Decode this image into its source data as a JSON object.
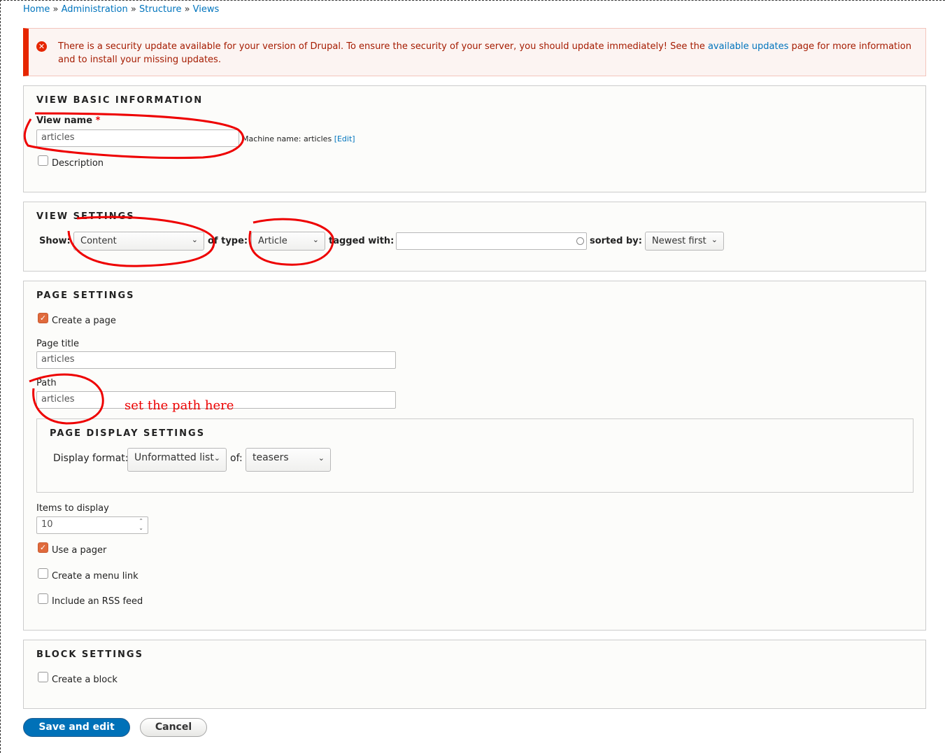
{
  "breadcrumb": [
    "Home",
    "Administration",
    "Structure",
    "Views"
  ],
  "message": {
    "text_before": "There is a security update available for your version of Drupal. To ensure the security of your server, you should update immediately! See the ",
    "link": "available updates",
    "text_after": " page for more information and to install your missing updates.",
    "icon": "error-circle-icon"
  },
  "basic": {
    "legend": "VIEW BASIC INFORMATION",
    "name_label": "View name",
    "required": "*",
    "name_value": "articles",
    "machine_label": "Machine name: articles",
    "edit": "[Edit]",
    "description": "Description"
  },
  "settings": {
    "legend": "VIEW SETTINGS",
    "show": "Show:",
    "show_value": "Content",
    "of_type": "of type:",
    "type_value": "Article",
    "tagged": "tagged with:",
    "tagged_value": "",
    "sorted": "sorted by:",
    "sorted_value": "Newest first"
  },
  "page": {
    "legend": "PAGE SETTINGS",
    "create": "Create a page",
    "create_checked": true,
    "title_label": "Page title",
    "title_value": "articles",
    "path_label": "Path",
    "path_value": "articles",
    "display": {
      "legend": "PAGE DISPLAY SETTINGS",
      "format_label": "Display format:",
      "format_value": "Unformatted list",
      "of": "of:",
      "of_value": "teasers"
    },
    "items_label": "Items to display",
    "items_value": "10",
    "pager": "Use a pager",
    "pager_checked": true,
    "menu": "Create a menu link",
    "menu_checked": false,
    "rss": "Include an RSS feed",
    "rss_checked": false
  },
  "block": {
    "legend": "BLOCK SETTINGS",
    "create": "Create a block",
    "create_checked": false
  },
  "actions": {
    "save": "Save and edit",
    "cancel": "Cancel"
  },
  "annotation": {
    "note": "set the path here",
    "color": "#e00000"
  }
}
